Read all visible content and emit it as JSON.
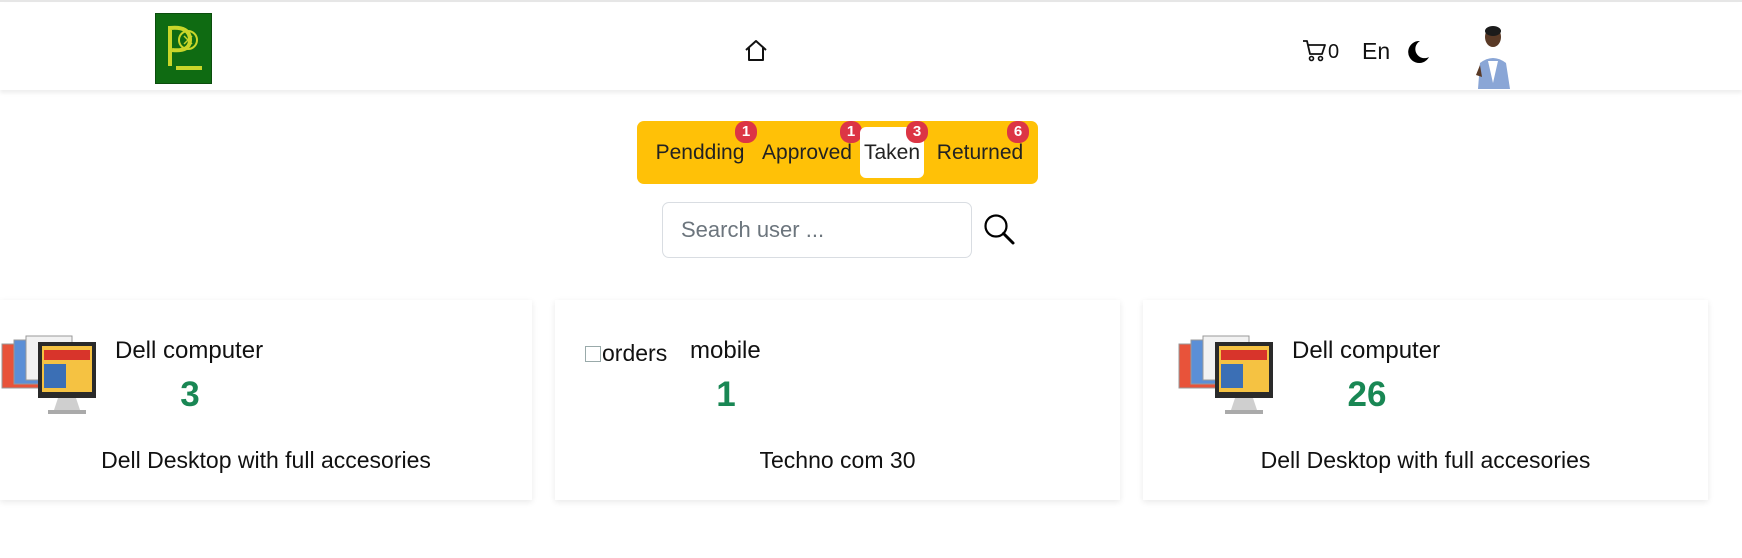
{
  "navbar": {
    "cart_count": "0",
    "language": "En"
  },
  "tabs": [
    {
      "label": "Pendding",
      "badge": "1",
      "active": false
    },
    {
      "label": "Approved",
      "badge": "1",
      "active": false
    },
    {
      "label": "Taken",
      "badge": "3",
      "active": true
    },
    {
      "label": "Returned",
      "badge": "6",
      "active": false
    }
  ],
  "search": {
    "placeholder": "Search user ...",
    "value": ""
  },
  "cards": [
    {
      "title": "Dell computer",
      "count": "3",
      "description": "Dell Desktop with full accesories",
      "image_alt": ""
    },
    {
      "title": "mobile",
      "count": "1",
      "description": "Techno com 30",
      "image_alt": "orders"
    },
    {
      "title": "Dell computer",
      "count": "26",
      "description": "Dell Desktop with full accesories",
      "image_alt": ""
    }
  ],
  "colors": {
    "tab_bar": "#ffc107",
    "badge": "#dc3545",
    "count": "#198754",
    "logo": "#0f6b12"
  },
  "icons": [
    "home-icon",
    "cart-icon",
    "moon-icon",
    "search-icon"
  ]
}
